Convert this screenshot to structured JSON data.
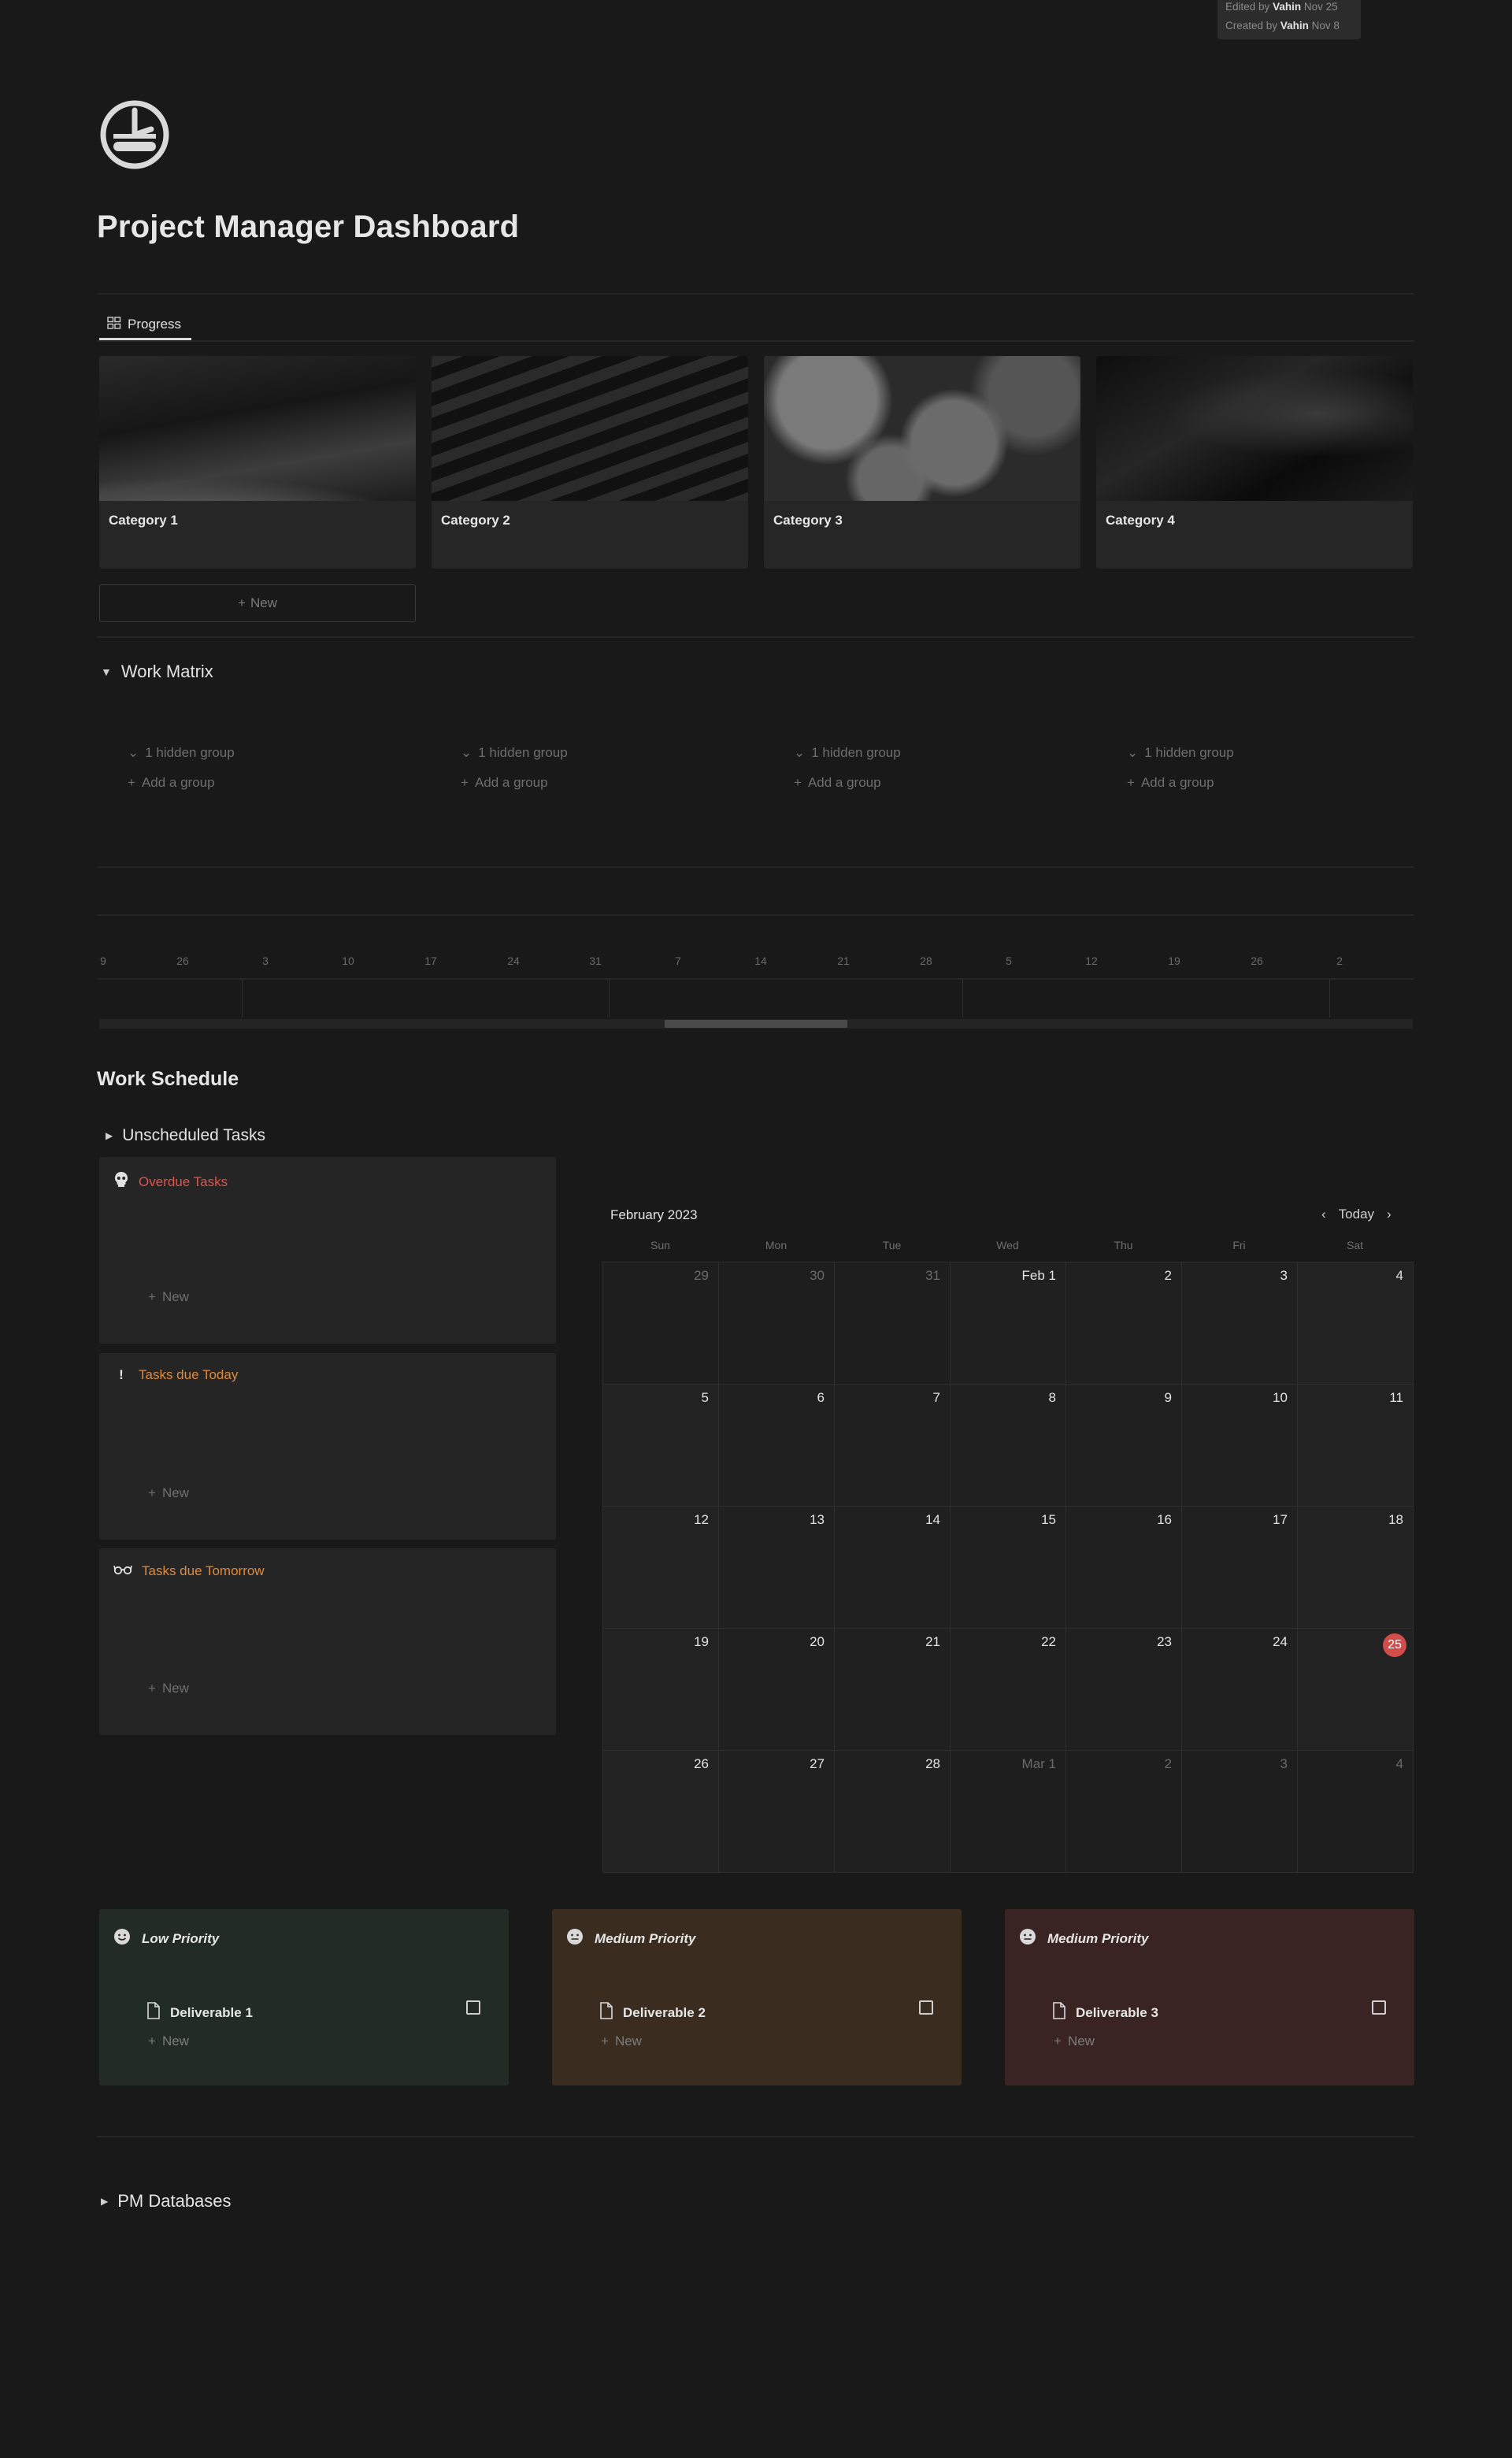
{
  "meta": {
    "edited_prefix": "Edited by",
    "edited_user": "Vahin",
    "edited_date": "Nov 25",
    "created_prefix": "Created by",
    "created_user": "Vahin",
    "created_date": "Nov 8"
  },
  "page": {
    "title": "Project Manager Dashboard",
    "icon": "dashboard-gauge-icon"
  },
  "progress": {
    "tab_label": "Progress",
    "tab_icon": "gallery-grid-icon",
    "cards": [
      {
        "label": "Category 1"
      },
      {
        "label": "Category 2"
      },
      {
        "label": "Category 3"
      },
      {
        "label": "Category 4"
      }
    ],
    "new_label": "New"
  },
  "work_matrix": {
    "title": "Work Matrix",
    "columns": [
      {
        "hidden": "1 hidden group",
        "add": "Add a group"
      },
      {
        "hidden": "1 hidden group",
        "add": "Add a group"
      },
      {
        "hidden": "1 hidden group",
        "add": "Add a group"
      },
      {
        "hidden": "1 hidden group",
        "add": "Add a group"
      }
    ]
  },
  "timeline": {
    "ticks": [
      "9",
      "26",
      "3",
      "10",
      "17",
      "24",
      "31",
      "7",
      "14",
      "21",
      "28",
      "5",
      "12",
      "19",
      "26",
      "2"
    ]
  },
  "work_schedule": {
    "title": "Work Schedule",
    "unscheduled_label": "Unscheduled Tasks",
    "panels": [
      {
        "title": "Overdue Tasks",
        "icon": "skull-icon",
        "color": "#e0524d",
        "new_label": "New"
      },
      {
        "title": "Tasks due Today",
        "icon": "exclamation-icon",
        "color": "#e08a3c",
        "new_label": "New"
      },
      {
        "title": "Tasks due Tomorrow",
        "icon": "glasses-icon",
        "color": "#e08a3c",
        "new_label": "New"
      }
    ]
  },
  "calendar": {
    "month": "February 2023",
    "today_label": "Today",
    "days_of_week": [
      "Sun",
      "Mon",
      "Tue",
      "Wed",
      "Thu",
      "Fri",
      "Sat"
    ],
    "today": "25",
    "accent": "#d04d4a",
    "weeks": [
      [
        {
          "d": "29",
          "o": true
        },
        {
          "d": "30",
          "o": true
        },
        {
          "d": "31",
          "o": true
        },
        {
          "d": "Feb 1",
          "o": false
        },
        {
          "d": "2",
          "o": false
        },
        {
          "d": "3",
          "o": false
        },
        {
          "d": "4",
          "o": false
        }
      ],
      [
        {
          "d": "5",
          "o": false
        },
        {
          "d": "6",
          "o": false
        },
        {
          "d": "7",
          "o": false
        },
        {
          "d": "8",
          "o": false
        },
        {
          "d": "9",
          "o": false
        },
        {
          "d": "10",
          "o": false
        },
        {
          "d": "11",
          "o": false
        }
      ],
      [
        {
          "d": "12",
          "o": false
        },
        {
          "d": "13",
          "o": false
        },
        {
          "d": "14",
          "o": false
        },
        {
          "d": "15",
          "o": false
        },
        {
          "d": "16",
          "o": false
        },
        {
          "d": "17",
          "o": false
        },
        {
          "d": "18",
          "o": false
        }
      ],
      [
        {
          "d": "19",
          "o": false
        },
        {
          "d": "20",
          "o": false
        },
        {
          "d": "21",
          "o": false
        },
        {
          "d": "22",
          "o": false
        },
        {
          "d": "23",
          "o": false
        },
        {
          "d": "24",
          "o": false
        },
        {
          "d": "25",
          "o": false
        }
      ],
      [
        {
          "d": "26",
          "o": false
        },
        {
          "d": "27",
          "o": false
        },
        {
          "d": "28",
          "o": false
        },
        {
          "d": "Mar 1",
          "o": true
        },
        {
          "d": "2",
          "o": true
        },
        {
          "d": "3",
          "o": true
        },
        {
          "d": "4",
          "o": true
        }
      ]
    ]
  },
  "priorities": [
    {
      "title": "Low Priority",
      "icon": "smile-icon",
      "bg": "#232b26",
      "deliverable": "Deliverable 1",
      "new_label": "New"
    },
    {
      "title": "Medium Priority",
      "icon": "neutral-face-icon",
      "bg": "#3a2d1f",
      "deliverable": "Deliverable 2",
      "new_label": "New"
    },
    {
      "title": "Medium Priority",
      "icon": "neutral-face-icon",
      "bg": "#3a2423",
      "deliverable": "Deliverable 3",
      "new_label": "New"
    }
  ],
  "pm_databases": {
    "title": "PM Databases"
  }
}
